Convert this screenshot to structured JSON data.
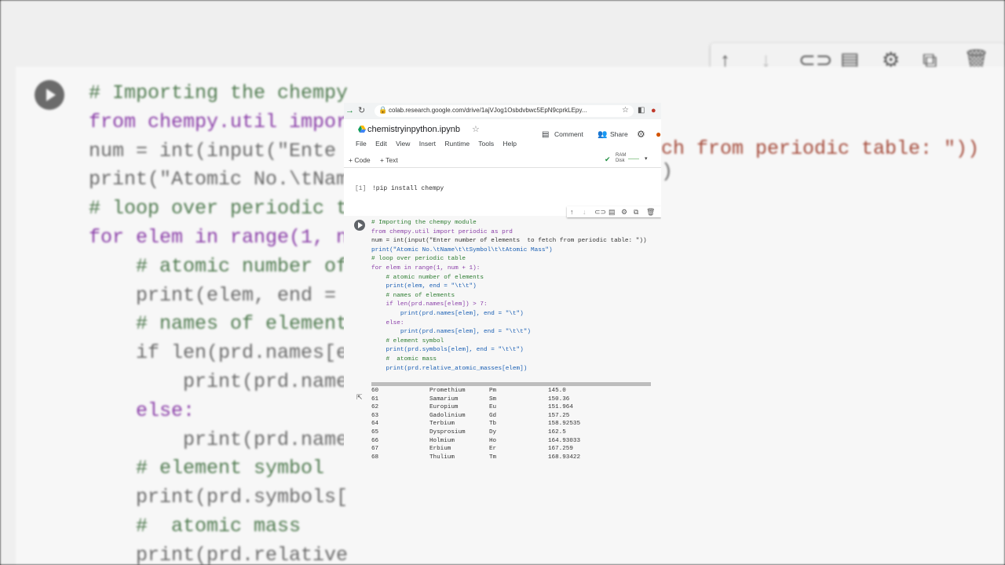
{
  "background": {
    "code_lines": [
      "# Importing the chempy",
      "from chempy.util impor",
      "num = int(input(\"Ente",
      "print(\"Atomic No.\\tNam",
      "# loop over periodic t",
      "for elem in range(1, n",
      "    # atomic number of",
      "    print(elem, end = ",
      "    # names of element",
      "    if len(prd.names[e",
      "        print(prd.name",
      "    else:",
      "        print(prd.name",
      "    # element symbol",
      "    print(prd.symbols[",
      "    #  atomic mass",
      "    print(prd.relative"
    ],
    "right_text_1": "ch from periodic table: \"))",
    "right_text_2": ")"
  },
  "browser": {
    "url": "colab.research.google.com/drive/1ajVJog1Osbdvbwc5EpN9cprkLEpy..."
  },
  "notebook": {
    "title": "chemistryinpython.ipynb",
    "menu": [
      "File",
      "Edit",
      "View",
      "Insert",
      "Runtime",
      "Tools",
      "Help"
    ],
    "comment_label": "Comment",
    "share_label": "Share",
    "add_code_label": "+ Code",
    "add_text_label": "+ Text",
    "ram_label": "RAM",
    "disk_label": "Disk"
  },
  "cell1": {
    "number": "[1]",
    "command": "!pip install chempy"
  },
  "cell2": {
    "code_lines": [
      "# Importing the chempy module",
      "from chempy.util import periodic as prd",
      "num = int(input(\"Enter number of elements  to fetch from periodic table: \"))",
      "print(\"Atomic No.\\tName\\t\\tSymbol\\t\\tAtomic Mass\")",
      "# loop over periodic table",
      "for elem in range(1, num + 1):",
      "    # atomic number of elements",
      "    print(elem, end = \"\\t\\t\")",
      "    # names of elements",
      "    if len(prd.names[elem]) > 7:",
      "        print(prd.names[elem], end = \"\\t\")",
      "    else:",
      "        print(prd.names[elem], end = \"\\t\\t\")",
      "    # element symbol",
      "    print(prd.symbols[elem], end = \"\\t\\t\")",
      "    #  atomic mass",
      "    print(prd.relative_atomic_masses[elem])"
    ],
    "output_rows": [
      {
        "num": "60",
        "name": "Promethium",
        "symbol": "Pm",
        "mass": "145.0"
      },
      {
        "num": "61",
        "name": "Samarium",
        "symbol": "Sm",
        "mass": "150.36"
      },
      {
        "num": "62",
        "name": "Europium",
        "symbol": "Eu",
        "mass": "151.964"
      },
      {
        "num": "63",
        "name": "Gadolinium",
        "symbol": "Gd",
        "mass": "157.25"
      },
      {
        "num": "64",
        "name": "Terbium",
        "symbol": "Tb",
        "mass": "158.92535"
      },
      {
        "num": "65",
        "name": "Dysprosium",
        "symbol": "Dy",
        "mass": "162.5"
      },
      {
        "num": "66",
        "name": "Holmium",
        "symbol": "Ho",
        "mass": "164.93033"
      },
      {
        "num": "67",
        "name": "Erbium",
        "symbol": "Er",
        "mass": "167.259"
      },
      {
        "num": "68",
        "name": "Thulium",
        "symbol": "Tm",
        "mass": "168.93422"
      }
    ]
  },
  "colors": {
    "keyword": "#8a3ea8",
    "comment": "#2e7d32",
    "builtin": "#1a5fb4",
    "string": "#a31515",
    "run_button": "#5f6368",
    "connected": "#1e8e3e"
  }
}
